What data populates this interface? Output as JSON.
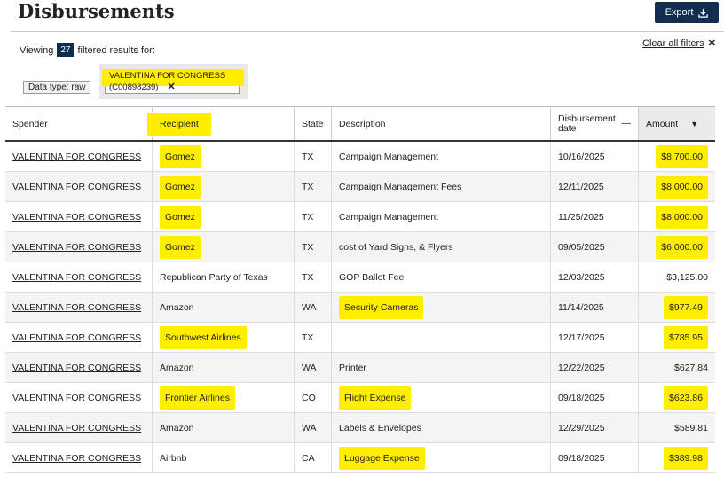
{
  "page": {
    "title": "Disbursements",
    "export_label": "Export",
    "clear_filters_label": "Clear all filters"
  },
  "filters": {
    "viewing_prefix": "Viewing",
    "count": "27",
    "viewing_suffix": "filtered results for:",
    "data_type": "Data type: raw",
    "committee_line1": "VALENTINA FOR CONGRESS",
    "committee_line2": "(C00898239)"
  },
  "table": {
    "headers": {
      "spender": "Spender",
      "recipient": "Recipient",
      "state": "State",
      "description": "Description",
      "date_line1": "Disbursement",
      "date_line2": "date",
      "amount": "Amount"
    },
    "rows": [
      {
        "spender": "VALENTINA FOR CONGRESS",
        "recipient": "Gomez",
        "state": "TX",
        "description": "Campaign Management",
        "date": "10/16/2025",
        "amount": "$8,700.00"
      },
      {
        "spender": "VALENTINA FOR CONGRESS",
        "recipient": "Gomez",
        "state": "TX",
        "description": "Campaign Management Fees",
        "date": "12/11/2025",
        "amount": "$8,000.00"
      },
      {
        "spender": "VALENTINA FOR CONGRESS",
        "recipient": "Gomez",
        "state": "TX",
        "description": "Campaign Management",
        "date": "11/25/2025",
        "amount": "$8,000.00"
      },
      {
        "spender": "VALENTINA FOR CONGRESS",
        "recipient": "Gomez",
        "state": "TX",
        "description": "cost of Yard Signs, & Flyers",
        "date": "09/05/2025",
        "amount": "$6,000.00"
      },
      {
        "spender": "VALENTINA FOR CONGRESS",
        "recipient": "Republican Party of Texas",
        "state": "TX",
        "description": "GOP Ballot Fee",
        "date": "12/03/2025",
        "amount": "$3,125.00"
      },
      {
        "spender": "VALENTINA FOR CONGRESS",
        "recipient": "Amazon",
        "state": "WA",
        "description": "Security Cameras",
        "date": "11/14/2025",
        "amount": "$977.49"
      },
      {
        "spender": "VALENTINA FOR CONGRESS",
        "recipient": "Southwest Airlines",
        "state": "TX",
        "description": "",
        "date": "12/17/2025",
        "amount": "$785.95"
      },
      {
        "spender": "VALENTINA FOR CONGRESS",
        "recipient": "Amazon",
        "state": "WA",
        "description": "Printer",
        "date": "12/22/2025",
        "amount": "$627.84"
      },
      {
        "spender": "VALENTINA FOR CONGRESS",
        "recipient": "Frontier Airlines",
        "state": "CO",
        "description": "Flight Expense",
        "date": "09/18/2025",
        "amount": "$623.86"
      },
      {
        "spender": "VALENTINA FOR CONGRESS",
        "recipient": "Amazon",
        "state": "WA",
        "description": "Labels & Envelopes",
        "date": "12/29/2025",
        "amount": "$589.81"
      },
      {
        "spender": "VALENTINA FOR CONGRESS",
        "recipient": "Airbnb",
        "state": "CA",
        "description": "Luggage Expense",
        "date": "09/18/2025",
        "amount": "$389.98"
      }
    ]
  },
  "colors": {
    "accent": "#112e51",
    "highlight": "#ffee00"
  }
}
